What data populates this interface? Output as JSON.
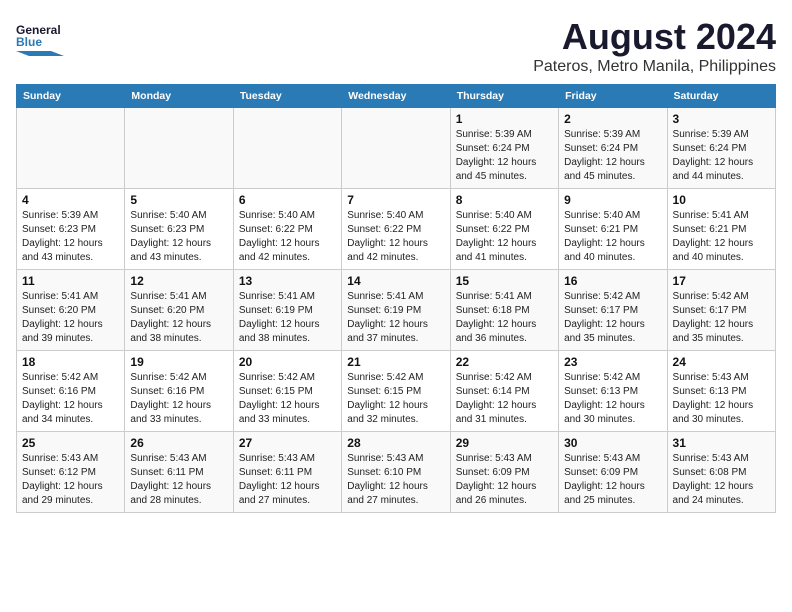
{
  "header": {
    "logo": {
      "line1": "General",
      "line2": "Blue"
    },
    "title": "August 2024",
    "subtitle": "Pateros, Metro Manila, Philippines"
  },
  "calendar": {
    "weekdays": [
      "Sunday",
      "Monday",
      "Tuesday",
      "Wednesday",
      "Thursday",
      "Friday",
      "Saturday"
    ],
    "weeks": [
      [
        {
          "day": "",
          "info": ""
        },
        {
          "day": "",
          "info": ""
        },
        {
          "day": "",
          "info": ""
        },
        {
          "day": "",
          "info": ""
        },
        {
          "day": "1",
          "sunrise": "5:39 AM",
          "sunset": "6:24 PM",
          "daylight": "12 hours and 45 minutes."
        },
        {
          "day": "2",
          "sunrise": "5:39 AM",
          "sunset": "6:24 PM",
          "daylight": "12 hours and 45 minutes."
        },
        {
          "day": "3",
          "sunrise": "5:39 AM",
          "sunset": "6:24 PM",
          "daylight": "12 hours and 44 minutes."
        }
      ],
      [
        {
          "day": "4",
          "sunrise": "5:39 AM",
          "sunset": "6:23 PM",
          "daylight": "12 hours and 43 minutes."
        },
        {
          "day": "5",
          "sunrise": "5:40 AM",
          "sunset": "6:23 PM",
          "daylight": "12 hours and 43 minutes."
        },
        {
          "day": "6",
          "sunrise": "5:40 AM",
          "sunset": "6:22 PM",
          "daylight": "12 hours and 42 minutes."
        },
        {
          "day": "7",
          "sunrise": "5:40 AM",
          "sunset": "6:22 PM",
          "daylight": "12 hours and 42 minutes."
        },
        {
          "day": "8",
          "sunrise": "5:40 AM",
          "sunset": "6:22 PM",
          "daylight": "12 hours and 41 minutes."
        },
        {
          "day": "9",
          "sunrise": "5:40 AM",
          "sunset": "6:21 PM",
          "daylight": "12 hours and 40 minutes."
        },
        {
          "day": "10",
          "sunrise": "5:41 AM",
          "sunset": "6:21 PM",
          "daylight": "12 hours and 40 minutes."
        }
      ],
      [
        {
          "day": "11",
          "sunrise": "5:41 AM",
          "sunset": "6:20 PM",
          "daylight": "12 hours and 39 minutes."
        },
        {
          "day": "12",
          "sunrise": "5:41 AM",
          "sunset": "6:20 PM",
          "daylight": "12 hours and 38 minutes."
        },
        {
          "day": "13",
          "sunrise": "5:41 AM",
          "sunset": "6:19 PM",
          "daylight": "12 hours and 38 minutes."
        },
        {
          "day": "14",
          "sunrise": "5:41 AM",
          "sunset": "6:19 PM",
          "daylight": "12 hours and 37 minutes."
        },
        {
          "day": "15",
          "sunrise": "5:41 AM",
          "sunset": "6:18 PM",
          "daylight": "12 hours and 36 minutes."
        },
        {
          "day": "16",
          "sunrise": "5:42 AM",
          "sunset": "6:17 PM",
          "daylight": "12 hours and 35 minutes."
        },
        {
          "day": "17",
          "sunrise": "5:42 AM",
          "sunset": "6:17 PM",
          "daylight": "12 hours and 35 minutes."
        }
      ],
      [
        {
          "day": "18",
          "sunrise": "5:42 AM",
          "sunset": "6:16 PM",
          "daylight": "12 hours and 34 minutes."
        },
        {
          "day": "19",
          "sunrise": "5:42 AM",
          "sunset": "6:16 PM",
          "daylight": "12 hours and 33 minutes."
        },
        {
          "day": "20",
          "sunrise": "5:42 AM",
          "sunset": "6:15 PM",
          "daylight": "12 hours and 33 minutes."
        },
        {
          "day": "21",
          "sunrise": "5:42 AM",
          "sunset": "6:15 PM",
          "daylight": "12 hours and 32 minutes."
        },
        {
          "day": "22",
          "sunrise": "5:42 AM",
          "sunset": "6:14 PM",
          "daylight": "12 hours and 31 minutes."
        },
        {
          "day": "23",
          "sunrise": "5:42 AM",
          "sunset": "6:13 PM",
          "daylight": "12 hours and 30 minutes."
        },
        {
          "day": "24",
          "sunrise": "5:43 AM",
          "sunset": "6:13 PM",
          "daylight": "12 hours and 30 minutes."
        }
      ],
      [
        {
          "day": "25",
          "sunrise": "5:43 AM",
          "sunset": "6:12 PM",
          "daylight": "12 hours and 29 minutes."
        },
        {
          "day": "26",
          "sunrise": "5:43 AM",
          "sunset": "6:11 PM",
          "daylight": "12 hours and 28 minutes."
        },
        {
          "day": "27",
          "sunrise": "5:43 AM",
          "sunset": "6:11 PM",
          "daylight": "12 hours and 27 minutes."
        },
        {
          "day": "28",
          "sunrise": "5:43 AM",
          "sunset": "6:10 PM",
          "daylight": "12 hours and 27 minutes."
        },
        {
          "day": "29",
          "sunrise": "5:43 AM",
          "sunset": "6:09 PM",
          "daylight": "12 hours and 26 minutes."
        },
        {
          "day": "30",
          "sunrise": "5:43 AM",
          "sunset": "6:09 PM",
          "daylight": "12 hours and 25 minutes."
        },
        {
          "day": "31",
          "sunrise": "5:43 AM",
          "sunset": "6:08 PM",
          "daylight": "12 hours and 24 minutes."
        }
      ]
    ],
    "labels": {
      "sunrise": "Sunrise:",
      "sunset": "Sunset:",
      "daylight": "Daylight:"
    }
  }
}
